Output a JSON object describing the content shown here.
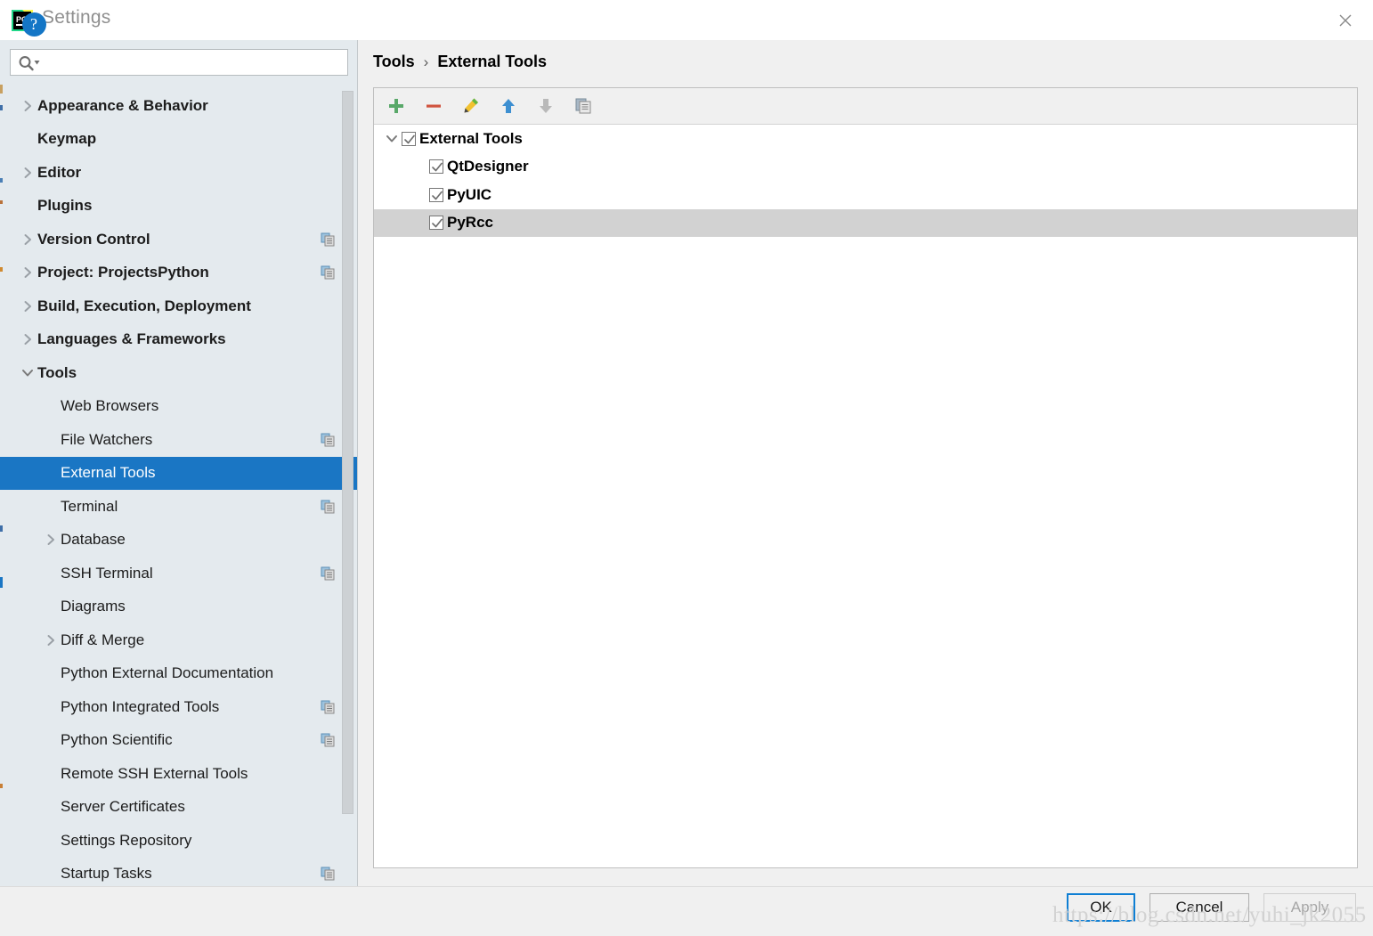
{
  "window": {
    "title": "Settings",
    "logo_icon": "pycharm-logo",
    "close_icon": "close-icon"
  },
  "search": {
    "value": "",
    "placeholder": "",
    "icon": "search-icon"
  },
  "sidebar": {
    "items": [
      {
        "label": "Appearance & Behavior",
        "level": 0,
        "bold": true,
        "chevron": "right",
        "copy_icon": false
      },
      {
        "label": "Keymap",
        "level": 0,
        "bold": true,
        "chevron": "none",
        "copy_icon": false
      },
      {
        "label": "Editor",
        "level": 0,
        "bold": true,
        "chevron": "right",
        "copy_icon": false
      },
      {
        "label": "Plugins",
        "level": 0,
        "bold": true,
        "chevron": "none",
        "copy_icon": false
      },
      {
        "label": "Version Control",
        "level": 0,
        "bold": true,
        "chevron": "right",
        "copy_icon": true
      },
      {
        "label": "Project: ProjectsPython",
        "level": 0,
        "bold": true,
        "chevron": "right",
        "copy_icon": true
      },
      {
        "label": "Build, Execution, Deployment",
        "level": 0,
        "bold": true,
        "chevron": "right",
        "copy_icon": false
      },
      {
        "label": "Languages & Frameworks",
        "level": 0,
        "bold": true,
        "chevron": "right",
        "copy_icon": false
      },
      {
        "label": "Tools",
        "level": 0,
        "bold": true,
        "chevron": "down",
        "copy_icon": false
      },
      {
        "label": "Web Browsers",
        "level": 1,
        "bold": false,
        "chevron": "none",
        "copy_icon": false
      },
      {
        "label": "File Watchers",
        "level": 1,
        "bold": false,
        "chevron": "none",
        "copy_icon": true
      },
      {
        "label": "External Tools",
        "level": 1,
        "bold": false,
        "chevron": "none",
        "copy_icon": false,
        "selected": true
      },
      {
        "label": "Terminal",
        "level": 1,
        "bold": false,
        "chevron": "none",
        "copy_icon": true
      },
      {
        "label": "Database",
        "level": 1,
        "bold": false,
        "chevron": "right",
        "copy_icon": false
      },
      {
        "label": "SSH Terminal",
        "level": 1,
        "bold": false,
        "chevron": "none",
        "copy_icon": true
      },
      {
        "label": "Diagrams",
        "level": 1,
        "bold": false,
        "chevron": "none",
        "copy_icon": false
      },
      {
        "label": "Diff & Merge",
        "level": 1,
        "bold": false,
        "chevron": "right",
        "copy_icon": false
      },
      {
        "label": "Python External Documentation",
        "level": 1,
        "bold": false,
        "chevron": "none",
        "copy_icon": false
      },
      {
        "label": "Python Integrated Tools",
        "level": 1,
        "bold": false,
        "chevron": "none",
        "copy_icon": true
      },
      {
        "label": "Python Scientific",
        "level": 1,
        "bold": false,
        "chevron": "none",
        "copy_icon": true
      },
      {
        "label": "Remote SSH External Tools",
        "level": 1,
        "bold": false,
        "chevron": "none",
        "copy_icon": false
      },
      {
        "label": "Server Certificates",
        "level": 1,
        "bold": false,
        "chevron": "none",
        "copy_icon": false
      },
      {
        "label": "Settings Repository",
        "level": 1,
        "bold": false,
        "chevron": "none",
        "copy_icon": false
      },
      {
        "label": "Startup Tasks",
        "level": 1,
        "bold": false,
        "chevron": "none",
        "copy_icon": true
      }
    ]
  },
  "breadcrumb": {
    "parent": "Tools",
    "separator": "›",
    "current": "External Tools"
  },
  "toolbar": {
    "buttons": [
      {
        "name": "add-button",
        "icon": "plus-icon",
        "enabled": true
      },
      {
        "name": "remove-button",
        "icon": "minus-icon",
        "enabled": true
      },
      {
        "name": "edit-button",
        "icon": "pencil-icon",
        "enabled": true
      },
      {
        "name": "move-up-button",
        "icon": "arrow-up-icon",
        "enabled": true
      },
      {
        "name": "move-down-button",
        "icon": "arrow-down-icon",
        "enabled": false
      },
      {
        "name": "copy-button",
        "icon": "copy-icon",
        "enabled": true
      }
    ]
  },
  "tools_tree": {
    "root": {
      "label": "External Tools",
      "checked": true,
      "expanded": true
    },
    "children": [
      {
        "label": "QtDesigner",
        "checked": true,
        "selected": false
      },
      {
        "label": "PyUIC",
        "checked": true,
        "selected": false
      },
      {
        "label": "PyRcc",
        "checked": true,
        "selected": true
      }
    ]
  },
  "footer": {
    "help_label": "?",
    "ok_label": "OK",
    "cancel_label": "Cancel",
    "apply_label": "Apply"
  },
  "watermark": {
    "text": "https://blog.csdn.net/yuhi_jk2055"
  },
  "colors": {
    "selection_blue": "#1a76c4",
    "row_selected_gray": "#d2d2d2",
    "sidebar_bg": "#e4eaee",
    "accent_focus": "#0f7fd4"
  }
}
